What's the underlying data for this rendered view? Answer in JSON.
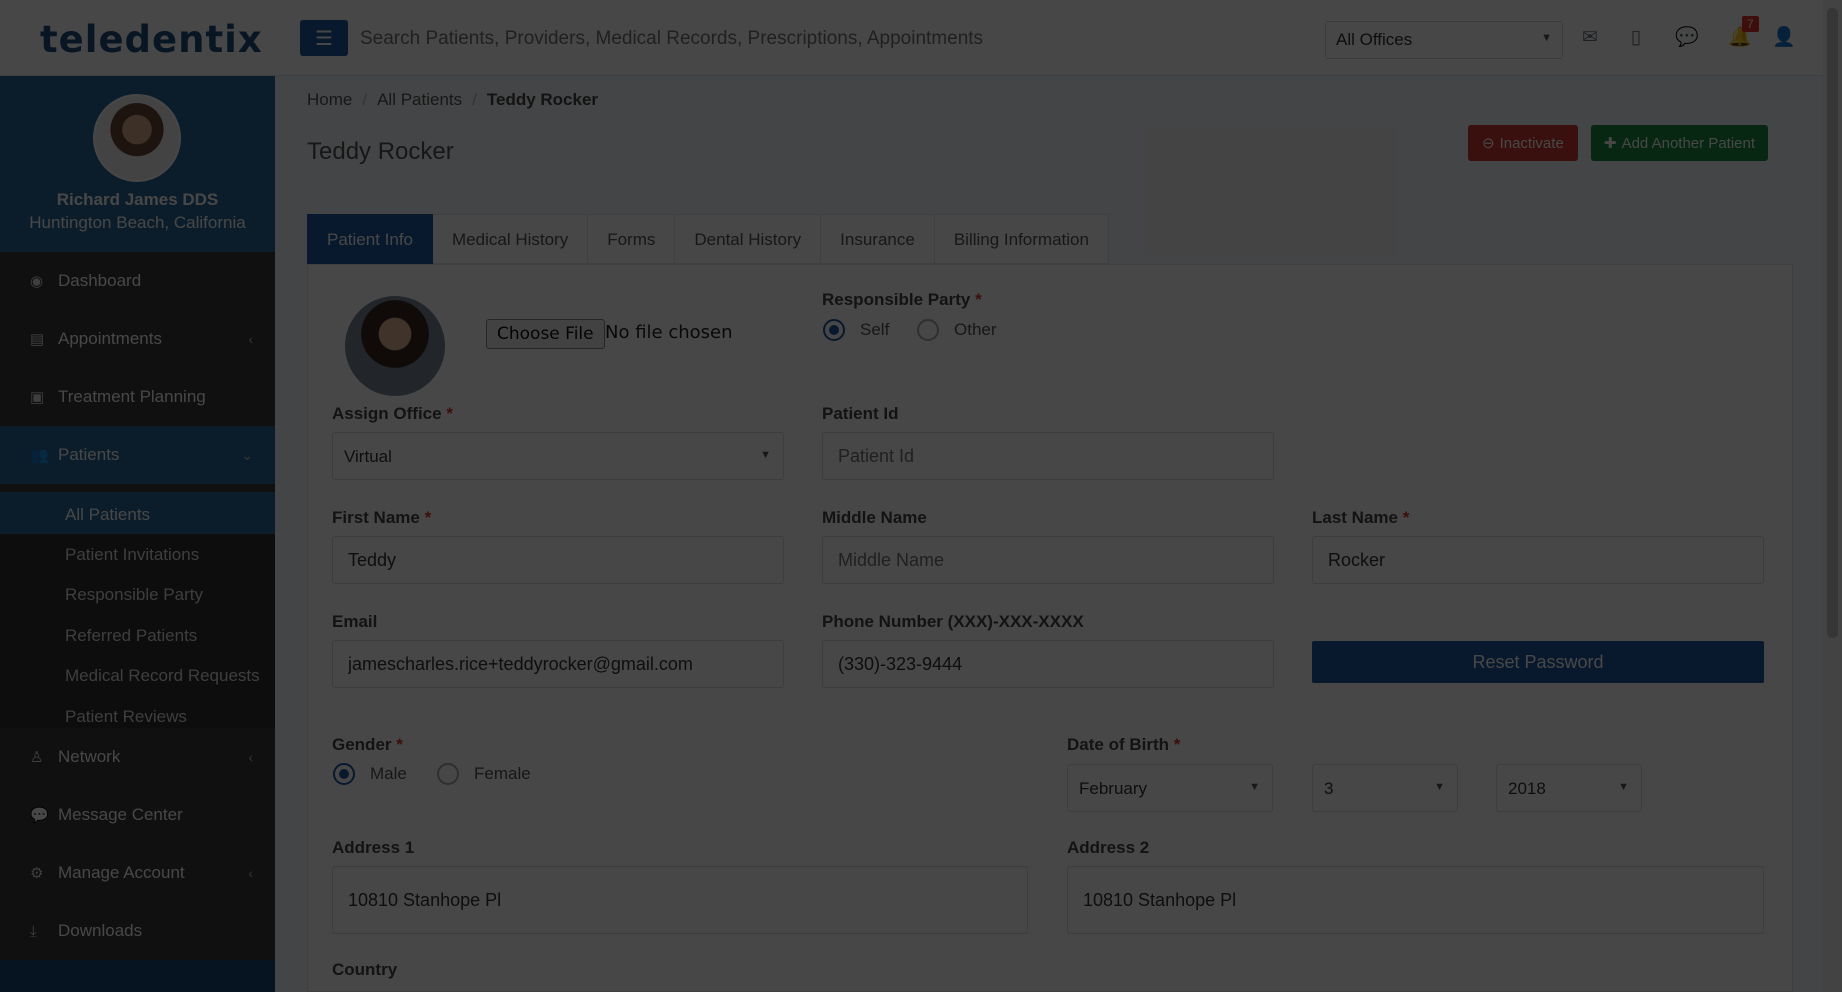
{
  "header": {
    "logo": "teledentix",
    "search_placeholder": "Search Patients, Providers, Medical Records, Prescriptions, Appointments",
    "office_select": "All Offices",
    "notification_count": "7"
  },
  "profile": {
    "name": "Richard James DDS",
    "location": "Huntington Beach, California"
  },
  "sidebar": {
    "items": [
      {
        "label": "Dashboard"
      },
      {
        "label": "Appointments"
      },
      {
        "label": "Treatment Planning"
      },
      {
        "label": "Patients"
      },
      {
        "label": "Network"
      },
      {
        "label": "Message Center"
      },
      {
        "label": "Manage Account"
      },
      {
        "label": "Downloads"
      }
    ],
    "patients_sub": [
      {
        "label": "All Patients"
      },
      {
        "label": "Patient Invitations"
      },
      {
        "label": "Responsible Party"
      },
      {
        "label": "Referred Patients"
      },
      {
        "label": "Medical Record Requests"
      },
      {
        "label": "Patient Reviews"
      }
    ]
  },
  "breadcrumb": {
    "home": "Home",
    "all_patients": "All Patients",
    "current": "Teddy Rocker"
  },
  "page_title": "Teddy Rocker",
  "buttons": {
    "inactivate": "Inactivate",
    "add_patient": "Add Another Patient",
    "reset_password": "Reset Password",
    "choose_file": "Choose File",
    "no_file": "No file chosen"
  },
  "tabs": [
    "Patient Info",
    "Medical History",
    "Forms",
    "Dental History",
    "Insurance",
    "Billing Information"
  ],
  "form": {
    "responsible_party_label": "Responsible Party",
    "responsible_options": [
      "Self",
      "Other"
    ],
    "assign_office_label": "Assign Office",
    "assign_office_value": "Virtual",
    "patient_id_label": "Patient Id",
    "patient_id_placeholder": "Patient Id",
    "first_name_label": "First Name",
    "first_name_value": "Teddy",
    "middle_name_label": "Middle Name",
    "middle_name_placeholder": "Middle Name",
    "last_name_label": "Last Name",
    "last_name_value": "Rocker",
    "email_label": "Email",
    "email_value": "jamescharles.rice+teddyrocker@gmail.com",
    "phone_label": "Phone Number (XXX)-XXX-XXXX",
    "phone_value": "(330)-323-9444",
    "gender_label": "Gender",
    "gender_options": [
      "Male",
      "Female"
    ],
    "dob_label": "Date of Birth",
    "dob_month": "February",
    "dob_day": "3",
    "dob_year": "2018",
    "address1_label": "Address 1",
    "address1_value": "10810 Stanhope Pl",
    "address2_label": "Address 2",
    "address2_value": "10810 Stanhope Pl",
    "country_label": "Country"
  },
  "colors": {
    "primary": "#1e5aa0",
    "danger": "#cc3a2f",
    "success": "#1c8c42",
    "sidebar": "#3a3a3a"
  }
}
